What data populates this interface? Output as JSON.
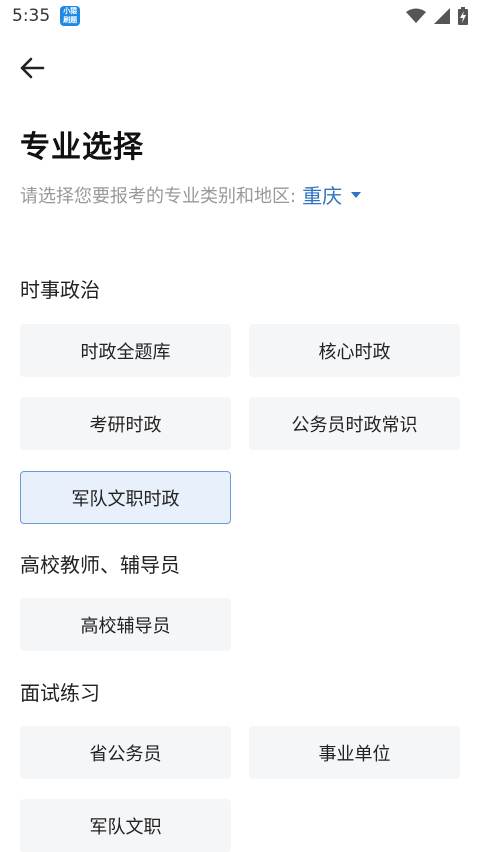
{
  "status_bar": {
    "time": "5:35",
    "app_badge": "小猿\n刷题"
  },
  "header": {
    "title": "专业选择"
  },
  "subtitle": {
    "text": "请选择您要报考的专业类别和地区:",
    "region": "重庆"
  },
  "sections": [
    {
      "heading": "时事政治",
      "options": [
        "时政全题库",
        "核心时政",
        "考研时政",
        "公务员时政常识",
        "军队文职时政"
      ],
      "selected": "军队文职时政"
    },
    {
      "heading": "高校教师、辅导员",
      "options": [
        "高校辅导员"
      ]
    },
    {
      "heading": "面试练习",
      "options": [
        "省公务员",
        "事业单位",
        "军队文职"
      ]
    }
  ],
  "colors": {
    "accent": "#2f74c0",
    "selected_border": "#6f9ad6",
    "selected_bg": "#e8f0fb",
    "option_bg": "#f5f6f8"
  }
}
